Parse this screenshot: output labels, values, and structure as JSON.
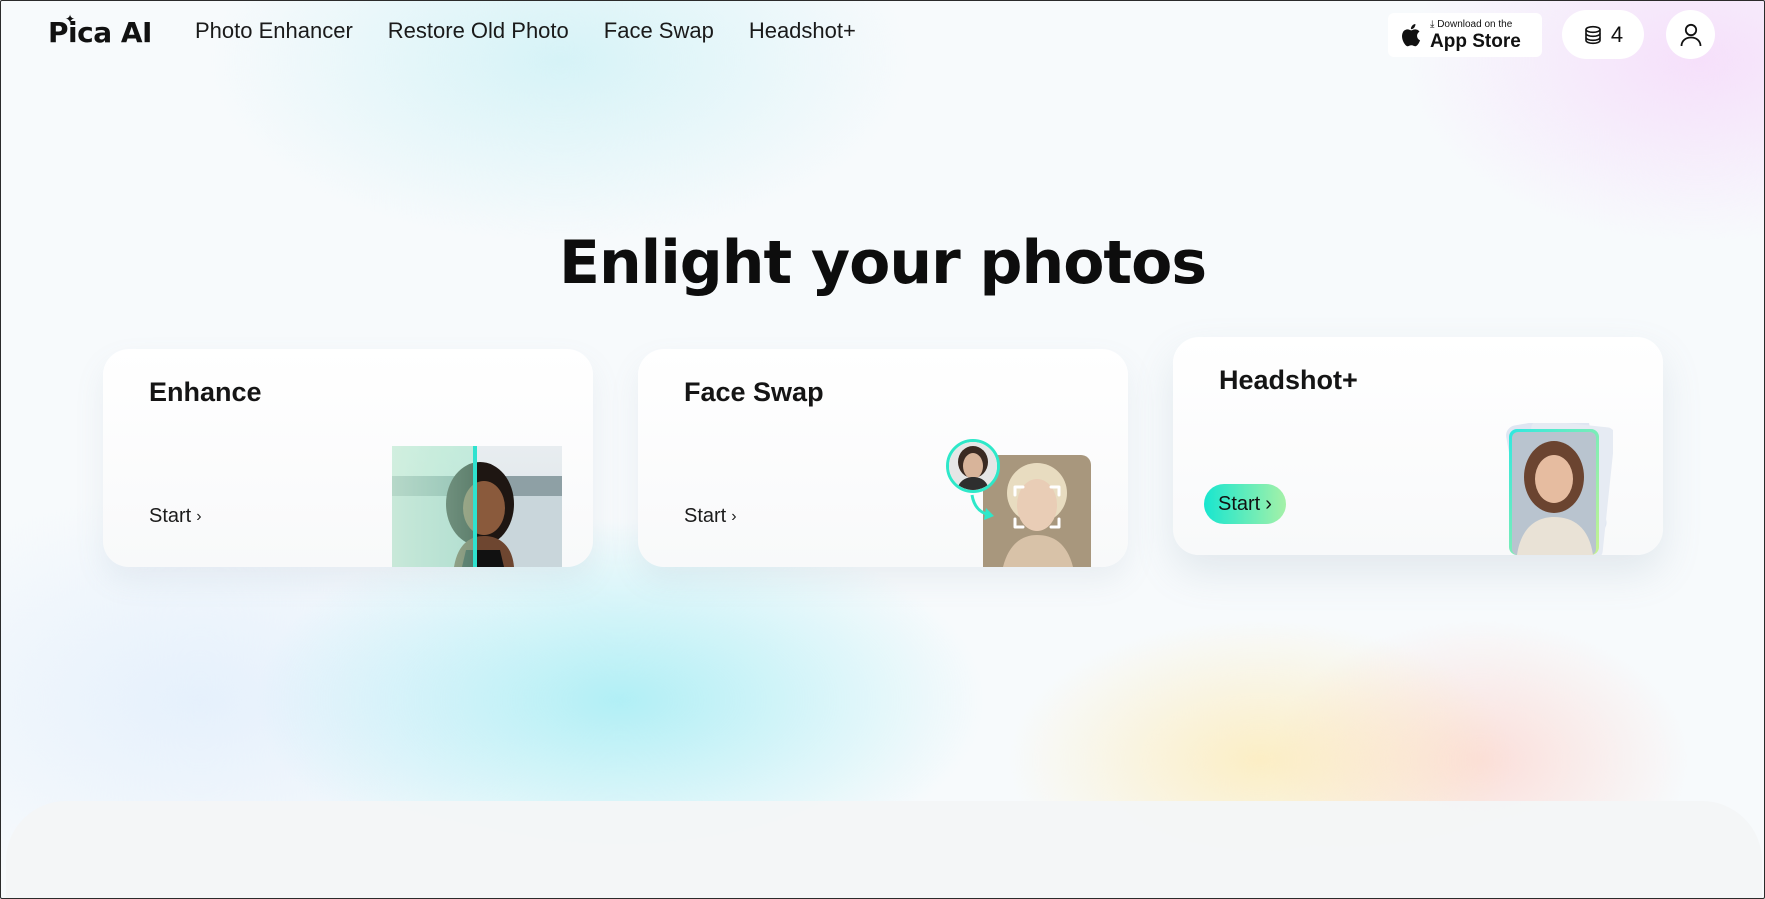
{
  "header": {
    "logo": "Pica AI",
    "nav": [
      "Photo Enhancer",
      "Restore Old Photo",
      "Face Swap",
      "Headshot+"
    ],
    "app_store": {
      "small": "Download on the",
      "big": "App Store"
    },
    "credits": "4"
  },
  "hero": {
    "title": "Enlight your photos"
  },
  "cards": [
    {
      "title": "Enhance",
      "cta": "Start"
    },
    {
      "title": "Face Swap",
      "cta": "Start"
    },
    {
      "title": "Headshot+",
      "cta": "Start"
    }
  ],
  "colors": {
    "accent_gradient_start": "#18e6cf",
    "accent_gradient_end": "#a5f1a8",
    "text": "#111111"
  },
  "icons": {
    "app_store": "apple-icon",
    "credits": "coins-stack-icon",
    "user": "user-icon"
  }
}
